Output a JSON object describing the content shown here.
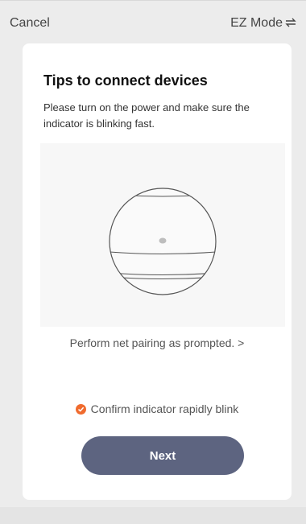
{
  "header": {
    "cancel_label": "Cancel",
    "mode_label": "EZ Mode",
    "mode_icon": "swap-arrows-icon"
  },
  "card": {
    "title": "Tips to connect devices",
    "description": "Please turn on the power and make sure the indicator is blinking fast.",
    "pairing_link": "Perform net pairing as prompted. >",
    "confirm_label": "Confirm indicator rapidly blink",
    "confirm_checked": true,
    "next_label": "Next"
  },
  "colors": {
    "accent_check": "#f06b2e",
    "button_bg": "#5d6480",
    "card_bg": "#ffffff",
    "page_bg": "#ececec"
  }
}
